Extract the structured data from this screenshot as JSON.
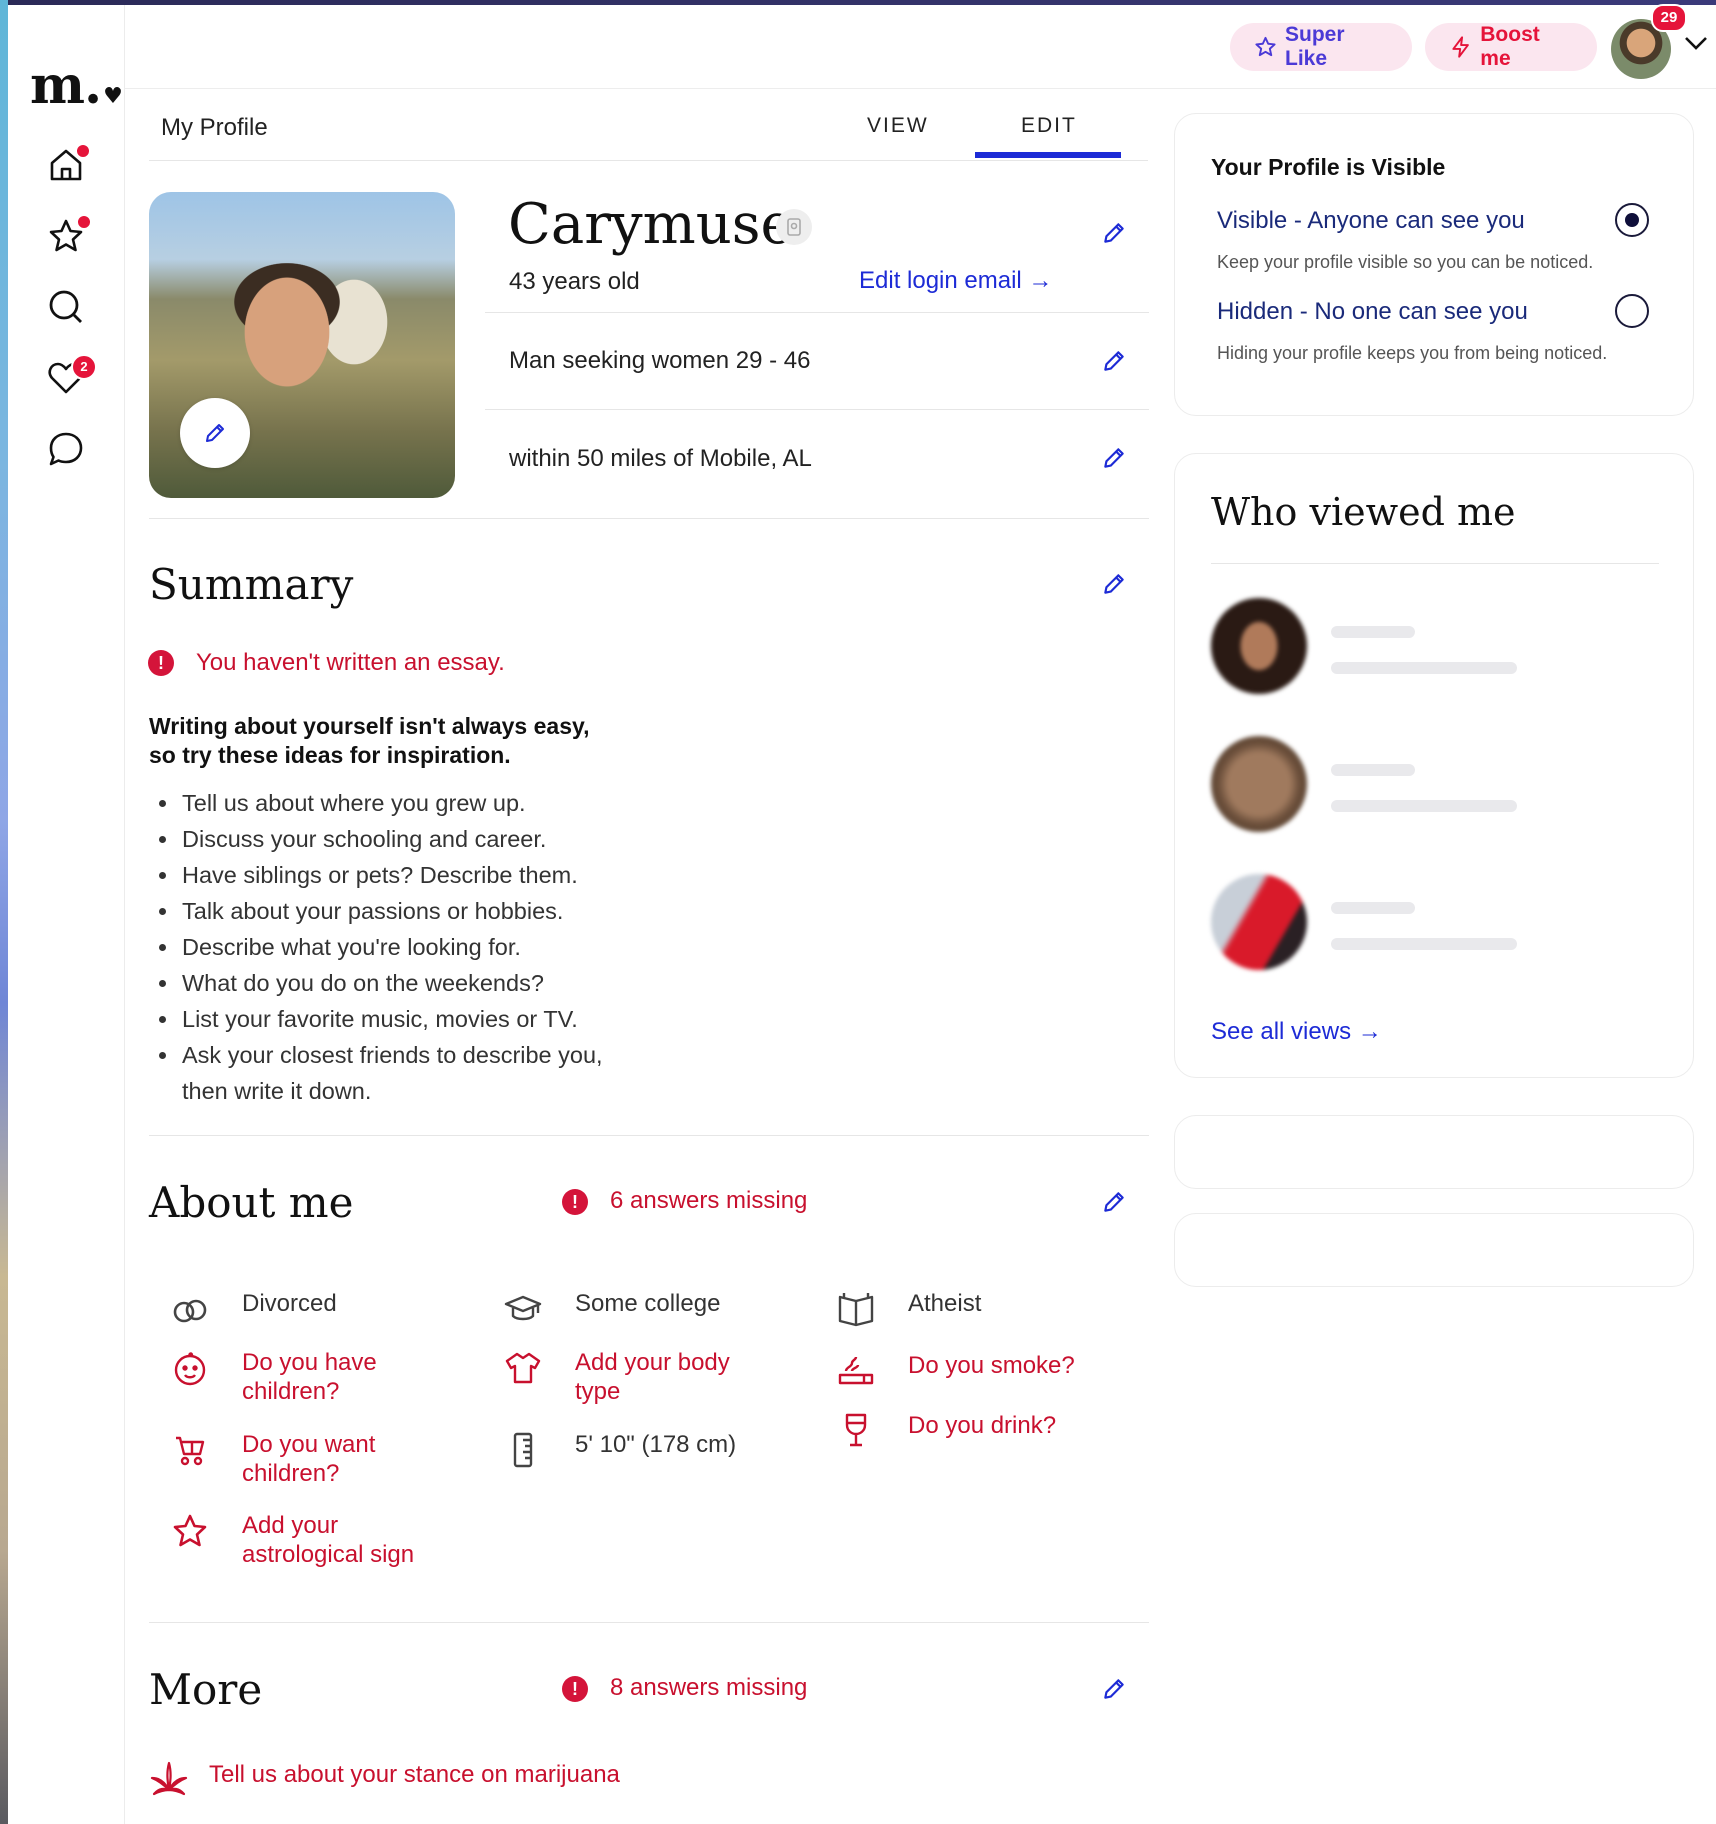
{
  "header": {
    "super_like": "Super Like",
    "boost_me": "Boost me",
    "avatar_badge": "29"
  },
  "sidebar": {
    "logo": "m.",
    "likes_badge": "2"
  },
  "profile": {
    "page_title": "My Profile",
    "tab_view": "VIEW",
    "tab_edit": "EDIT",
    "name": "Carymuse",
    "age": "43 years old",
    "edit_login": "Edit login email →",
    "seeking": "Man seeking women 29 - 46",
    "location": "within 50 miles of Mobile, AL"
  },
  "summary": {
    "title": "Summary",
    "error": "You haven't written an essay.",
    "prompt_line1": "Writing about yourself isn't always easy,",
    "prompt_line2": "so try these ideas for inspiration.",
    "tips": [
      "Tell us about where you grew up.",
      "Discuss your schooling and career.",
      "Have siblings or pets? Describe them.",
      "Talk about your passions or hobbies.",
      "Describe what you're looking for.",
      "What do you do on the weekends?",
      "List your favorite music, movies or TV.",
      "Ask your closest friends to describe you, then write it down."
    ]
  },
  "about": {
    "title": "About me",
    "missing": "6 answers missing",
    "items": {
      "divorced": "Divorced",
      "children": "Do you have children?",
      "want_children": "Do you want children?",
      "astro": "Add your astrological sign",
      "college": "Some college",
      "body": "Add your body type",
      "height": "5' 10\" (178 cm)",
      "religion": "Atheist",
      "smoke": "Do you smoke?",
      "drink": "Do you drink?"
    }
  },
  "more": {
    "title": "More",
    "missing": "8 answers missing",
    "marijuana": "Tell us about your stance on marijuana"
  },
  "visibility": {
    "title": "Your Profile is Visible",
    "visible_label": "Visible - Anyone can see you",
    "visible_sub": "Keep your profile visible so you can be noticed.",
    "hidden_label": "Hidden - No one can see you",
    "hidden_sub": "Hiding your profile keeps you from being noticed.",
    "selected": "visible"
  },
  "who_viewed": {
    "title": "Who viewed me",
    "see_all": "See all views →"
  },
  "colors": {
    "accent_blue": "#1d2bd6",
    "error_red": "#c8102e",
    "pill_bg": "#fbe6ef"
  }
}
